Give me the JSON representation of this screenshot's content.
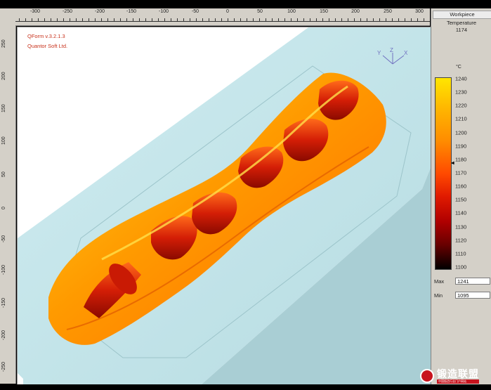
{
  "app": {
    "version": "QForm v.3.2.1.3",
    "company": "Quantor Soft Ltd."
  },
  "ruler": {
    "horizontal": [
      "-300",
      "-250",
      "-200",
      "-150",
      "-100",
      "-50",
      "0",
      "50",
      "100",
      "150",
      "200",
      "250",
      "300"
    ],
    "vertical": [
      "250",
      "200",
      "150",
      "100",
      "50",
      "0",
      "-50",
      "-100",
      "-150",
      "-200",
      "-250"
    ]
  },
  "axes": {
    "y": "Y",
    "z": "Z",
    "x": "X"
  },
  "panel": {
    "header": "Workpiece",
    "title": "Temperature",
    "current": "1174",
    "unit": "°C",
    "scale": [
      "1240",
      "1230",
      "1220",
      "1210",
      "1200",
      "1190",
      "1180",
      "1170",
      "1160",
      "1150",
      "1140",
      "1130",
      "1120",
      "1110",
      "1100"
    ],
    "max_label": "Max",
    "max_value": "1241",
    "min_label": "Min",
    "min_value": "1095"
  },
  "watermark": {
    "title": "锻造联盟",
    "subtitle": "中国锻造行业门户网站"
  },
  "colors": {
    "die": "#c3e6eb",
    "hot": "#ffb300",
    "accent": "#c8321c"
  }
}
